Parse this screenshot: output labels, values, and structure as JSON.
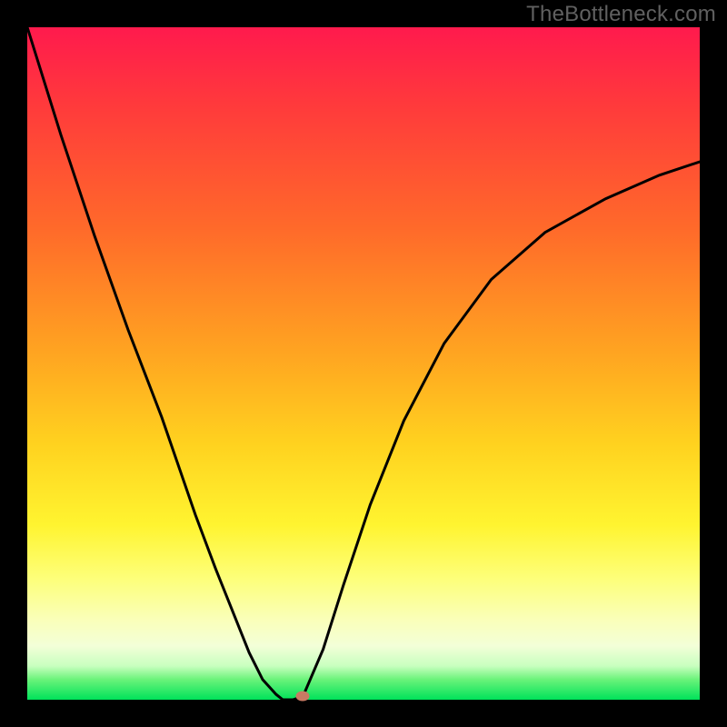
{
  "watermark": "TheBottleneck.com",
  "chart_data": {
    "type": "line",
    "title": "",
    "xlabel": "",
    "ylabel": "",
    "xlim": [
      0,
      1
    ],
    "ylim": [
      0,
      1
    ],
    "background": "red-yellow-green vertical gradient",
    "series": [
      {
        "name": "curve-left",
        "x": [
          0.0,
          0.05,
          0.1,
          0.15,
          0.2,
          0.25,
          0.28,
          0.31,
          0.33,
          0.35,
          0.37,
          0.38
        ],
        "y": [
          1.0,
          0.84,
          0.69,
          0.55,
          0.42,
          0.275,
          0.195,
          0.12,
          0.07,
          0.03,
          0.008,
          0.0
        ]
      },
      {
        "name": "curve-flat",
        "x": [
          0.38,
          0.395,
          0.41
        ],
        "y": [
          0.0,
          0.0,
          0.005
        ]
      },
      {
        "name": "curve-right",
        "x": [
          0.41,
          0.44,
          0.47,
          0.51,
          0.56,
          0.62,
          0.69,
          0.77,
          0.86,
          0.94,
          1.0
        ],
        "y": [
          0.005,
          0.075,
          0.17,
          0.29,
          0.415,
          0.53,
          0.625,
          0.695,
          0.745,
          0.78,
          0.8
        ]
      }
    ],
    "marker": {
      "x": 0.41,
      "y": 0.005
    }
  }
}
